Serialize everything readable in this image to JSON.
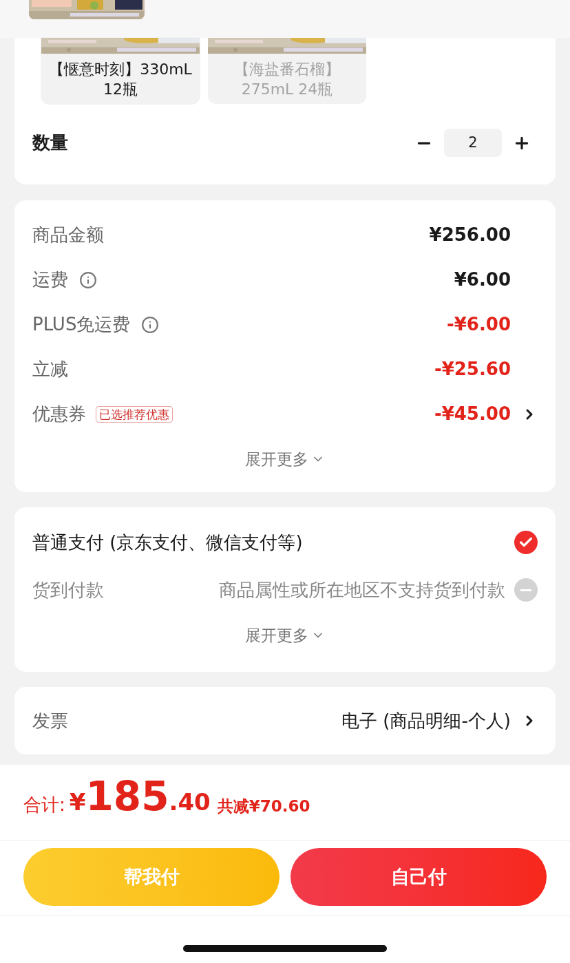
{
  "specs": [
    {
      "label": "【惬意时刻】330mL\n12瓶",
      "selected": true,
      "disabled": false
    },
    {
      "label": "【海盐番石榴】\n275mL 24瓶",
      "selected": false,
      "disabled": true
    }
  ],
  "quantity": {
    "label": "数量",
    "value": "2"
  },
  "price_rows": [
    {
      "label": "商品金额",
      "value": "¥256.00",
      "info": false,
      "discount": false,
      "arrow": false
    },
    {
      "label": "运费",
      "value": "¥6.00",
      "info": true,
      "discount": false,
      "arrow": false
    },
    {
      "label": "PLUS免运费",
      "value": "-¥6.00",
      "info": true,
      "discount": true,
      "arrow": false
    },
    {
      "label": "立减",
      "value": "-¥25.60",
      "info": false,
      "discount": true,
      "arrow": false
    },
    {
      "label": "优惠券",
      "tag": "已选推荐优惠",
      "value": "-¥45.00",
      "info": false,
      "discount": true,
      "arrow": true
    }
  ],
  "price_expand": "展开更多",
  "payment_options": [
    {
      "label": "普通支付 (京东支付、微信支付等)",
      "selected": true,
      "disabled": false
    },
    {
      "label": "货到付款",
      "note": "商品属性或所在地区不支持货到付款",
      "selected": false,
      "disabled": true
    }
  ],
  "payment_expand": "展开更多",
  "invoice": {
    "label": "发票",
    "value": "电子 (商品明细-个人)"
  },
  "footer": {
    "total_label": "合计:",
    "currency": "¥",
    "integer": "185",
    "decimal": ".40",
    "saved": "共减¥70.60"
  },
  "buttons": [
    {
      "label": "帮我付",
      "kind": "secondary"
    },
    {
      "label": "自己付",
      "kind": "primary"
    }
  ]
}
